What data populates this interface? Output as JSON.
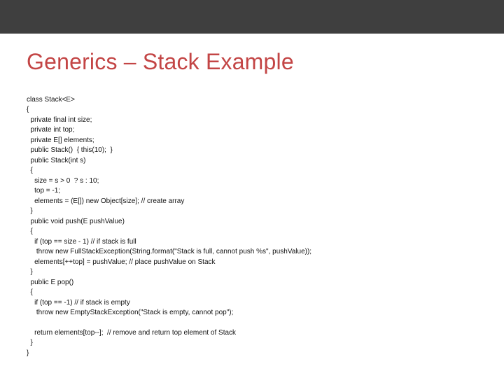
{
  "title": "Generics – Stack Example",
  "code": {
    "l01": "class Stack<E>",
    "l02": "{",
    "l03": "  private final int size;",
    "l04": "  private int top;",
    "l05": "  private E[] elements;",
    "l06": "  public Stack()  { this(10);  }",
    "l07": "  public Stack(int s)",
    "l08": "  {",
    "l09": "    size = s > 0  ? s : 10;",
    "l10": "    top = -1;",
    "l11": "    elements = (E[]) new Object[size]; // create array",
    "l12": "  }",
    "l13": "  public void push(E pushValue)",
    "l14": "  {",
    "l15": "    if (top == size - 1) // if stack is full",
    "l16": "     throw new FullStackException(String.format(\"Stack is full, cannot push %s\", pushValue));",
    "l17": "    elements[++top] = pushValue; // place pushValue on Stack",
    "l18": "  }",
    "l19": "  public E pop()",
    "l20": "  {",
    "l21": "    if (top == -1) // if stack is empty",
    "l22": "     throw new EmptyStackException(\"Stack is empty, cannot pop\");",
    "l23": "    return elements[top--];  // remove and return top element of Stack",
    "l24": "  }",
    "l25": "}"
  }
}
